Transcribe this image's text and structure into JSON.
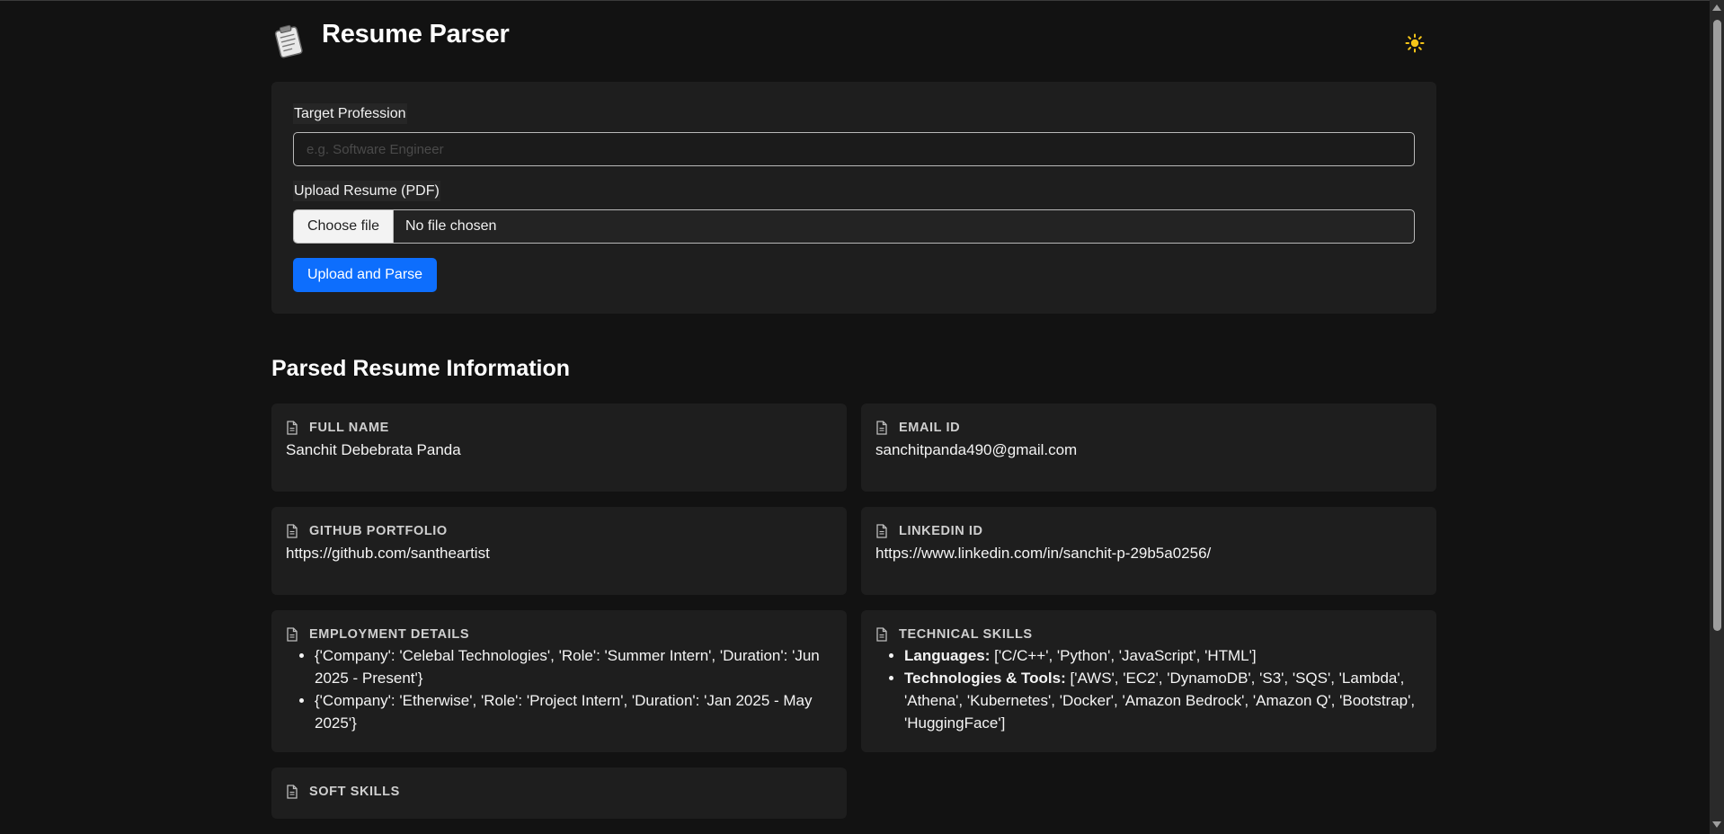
{
  "header": {
    "title": "Resume Parser",
    "logo_icon": "clipboard-icon",
    "theme_icon": "sun-icon",
    "theme_icon_color": "#f5c518"
  },
  "form": {
    "profession_label": "Target Profession",
    "profession_placeholder": "e.g. Software Engineer",
    "upload_label": "Upload Resume (PDF)",
    "choose_file_label": "Choose file",
    "file_status": "No file chosen",
    "submit_label": "Upload and Parse",
    "accent_color": "#0d6efd"
  },
  "results": {
    "title": "Parsed Resume Information",
    "cards": {
      "full_name": {
        "label": "FULL NAME",
        "value": "Sanchit Debebrata Panda"
      },
      "email": {
        "label": "EMAIL ID",
        "value": "sanchitpanda490@gmail.com"
      },
      "github": {
        "label": "GITHUB PORTFOLIO",
        "value": "https://github.com/santheartist"
      },
      "linkedin": {
        "label": "LINKEDIN ID",
        "value": "https://www.linkedin.com/in/sanchit-p-29b5a0256/"
      },
      "employment": {
        "label": "EMPLOYMENT DETAILS",
        "items": [
          "{'Company': 'Celebal Technologies', 'Role': 'Summer Intern', 'Duration': 'Jun 2025 - Present'}",
          "{'Company': 'Etherwise', 'Role': 'Project Intern', 'Duration': 'Jan 2025 - May 2025'}"
        ]
      },
      "technical": {
        "label": "TECHNICAL SKILLS",
        "items": [
          {
            "key": "Languages:",
            "value": " ['C/C++', 'Python', 'JavaScript', 'HTML']"
          },
          {
            "key": "Technologies & Tools:",
            "value": " ['AWS', 'EC2', 'DynamoDB', 'S3', 'SQS', 'Lambda', 'Athena', 'Kubernetes', 'Docker', 'Amazon Bedrock', 'Amazon Q', 'Bootstrap', 'HuggingFace']"
          }
        ]
      },
      "soft_skills": {
        "label": "SOFT SKILLS"
      }
    },
    "card_icon": "document-icon"
  }
}
